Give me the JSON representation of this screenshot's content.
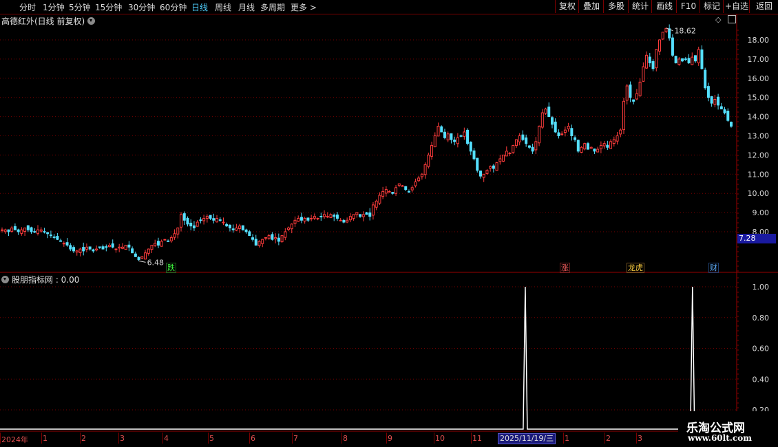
{
  "toolbar": {
    "timeframes": [
      {
        "label": "分时",
        "active": false
      },
      {
        "label": "1分钟",
        "active": false
      },
      {
        "label": "5分钟",
        "active": false
      },
      {
        "label": "15分钟",
        "active": false
      },
      {
        "label": "30分钟",
        "active": false
      },
      {
        "label": "60分钟",
        "active": false
      },
      {
        "label": "日线",
        "active": true
      },
      {
        "label": "周线",
        "active": false
      },
      {
        "label": "月线",
        "active": false
      },
      {
        "label": "多周期",
        "active": false
      },
      {
        "label": "更多 >",
        "active": false
      }
    ],
    "buttons": [
      "复权",
      "叠加",
      "多股",
      "统计",
      "画线",
      "F10",
      "标记",
      "+自选",
      "返回"
    ]
  },
  "main_chart": {
    "title": "高德红外(日线 前复权)",
    "high_label": "18.62",
    "low_label": "6.48",
    "current_price": "7.28",
    "colors": {
      "up": "#ff3c3c",
      "down": "#55e0ff",
      "grid": "#7a0000",
      "accent_blue": "#1a1aa0"
    },
    "markers": [
      {
        "text": "跌",
        "color": "#40ff40"
      },
      {
        "text": "涨",
        "color": "#ff6060"
      },
      {
        "text": "龙虎",
        "color": "#ffd040"
      },
      {
        "text": "财",
        "color": "#60b0ff"
      }
    ]
  },
  "indicator": {
    "title": "股朋指标网 : 0.00"
  },
  "x_axis": {
    "labels": [
      "2024年",
      "1",
      "2",
      "3",
      "4",
      "5",
      "6",
      "7",
      "8",
      "9",
      "10",
      "11",
      "1",
      "2",
      "3"
    ],
    "cursor_date": "2025/11/19/三"
  },
  "watermark": {
    "line1": "乐淘公式网",
    "line2": "www.60lt.com"
  },
  "chart_data": [
    {
      "type": "candlestick",
      "title": "高德红外(日线 前复权)",
      "y_ticks": [
        "18.00",
        "17.00",
        "16.00",
        "15.00",
        "14.00",
        "13.00",
        "12.00",
        "11.00",
        "10.00",
        "9.00",
        "8.00"
      ],
      "ylim": [
        6.0,
        19.0
      ],
      "n_bars": 225,
      "close_anchors": [
        [
          0,
          8.1
        ],
        [
          12,
          8.1
        ],
        [
          20,
          7.7
        ],
        [
          24,
          7.0
        ],
        [
          30,
          7.1
        ],
        [
          40,
          7.2
        ],
        [
          48,
          6.55
        ],
        [
          56,
          7.3
        ],
        [
          62,
          7.9
        ],
        [
          66,
          8.6
        ],
        [
          72,
          8.3
        ],
        [
          80,
          8.7
        ],
        [
          92,
          8.3
        ],
        [
          100,
          8.1
        ],
        [
          104,
          7.5
        ],
        [
          110,
          7.5
        ],
        [
          118,
          8.0
        ],
        [
          124,
          8.6
        ],
        [
          134,
          8.8
        ],
        [
          148,
          8.8
        ],
        [
          160,
          9.6
        ],
        [
          170,
          10.3
        ],
        [
          182,
          10.4
        ],
        [
          190,
          12.0
        ],
        [
          196,
          13.5
        ],
        [
          200,
          12.9
        ],
        [
          210,
          12.9
        ],
        [
          214,
          11.2
        ],
        [
          220,
          11.6
        ]
      ],
      "closes": [
        8.1,
        8.1,
        8.0,
        8.2,
        8.1,
        8.0,
        8.1,
        8.2,
        8.1,
        8.0,
        8.0,
        8.1,
        8.1,
        8.0,
        7.9,
        7.8,
        7.7,
        7.6,
        7.5,
        7.4,
        7.3,
        7.1,
        7.0,
        7.0,
        7.1,
        7.0,
        7.2,
        7.1,
        7.0,
        7.1,
        7.2,
        7.1,
        7.2,
        7.3,
        7.2,
        7.1,
        7.2,
        7.2,
        7.3,
        7.2,
        6.9,
        6.7,
        6.55,
        6.7,
        6.9,
        7.1,
        7.3,
        7.4,
        7.3,
        7.5,
        7.6,
        7.5,
        7.7,
        7.9,
        8.2,
        8.9,
        8.6,
        8.4,
        8.3,
        8.2,
        8.5,
        8.6,
        8.7,
        8.8,
        8.7,
        8.6,
        8.7,
        8.6,
        8.5,
        8.3,
        8.2,
        8.1,
        8.2,
        8.3,
        8.1,
        8.0,
        7.8,
        7.6,
        7.3,
        7.5,
        7.6,
        7.7,
        7.8,
        7.6,
        7.7,
        7.5,
        7.8,
        8.0,
        8.2,
        8.4,
        8.6,
        8.7,
        8.6,
        8.7,
        8.6,
        8.7,
        8.8,
        8.7,
        8.8,
        8.9,
        8.8,
        8.9,
        8.8,
        8.7,
        8.6,
        8.5,
        8.6,
        8.8,
        8.9,
        9.0,
        8.8,
        8.9,
        8.9,
        8.8,
        9.4,
        9.6,
        9.9,
        10.1,
        10.2,
        10.1,
        10.0,
        10.3,
        10.5,
        10.4,
        10.2,
        10.1,
        10.3,
        10.6,
        10.8,
        11.0,
        11.5,
        12.0,
        12.5,
        13.0,
        13.5,
        13.2,
        12.9,
        13.1,
        12.8,
        12.7,
        12.9,
        13.0,
        13.2,
        12.6,
        12.2,
        11.8,
        11.2,
        10.9,
        11.0,
        11.2,
        11.4,
        11.3,
        11.6,
        11.8,
        12.0,
        12.2,
        12.1,
        12.5,
        12.8,
        13.0,
        12.8,
        12.6,
        12.4,
        12.2,
        12.7,
        13.5,
        14.2,
        14.4,
        14.0,
        13.6,
        13.2,
        13.0,
        13.1,
        13.3,
        13.5,
        13.0,
        12.8,
        12.2,
        12.4,
        12.6,
        12.3,
        12.4,
        12.2,
        12.3,
        12.5,
        12.6,
        12.4,
        12.7,
        12.8,
        13.0,
        13.3,
        14.8,
        15.6,
        15.0,
        14.8,
        15.2,
        15.8,
        16.6,
        17.2,
        16.8,
        16.5,
        17.5,
        18.0,
        18.4,
        18.6,
        18.1,
        17.2,
        16.8,
        17.0,
        16.9,
        17.0,
        16.8,
        17.1,
        16.9,
        17.5,
        16.5,
        15.5,
        15.0,
        14.7,
        14.9,
        14.6,
        14.4,
        14.2,
        13.8,
        13.5
      ]
    },
    {
      "type": "line",
      "title": "股朋指标网",
      "y_ticks": [
        "1.00",
        "0.80",
        "0.60",
        "0.40",
        "0.20"
      ],
      "ylim": [
        0,
        1.05
      ],
      "spikes": [
        {
          "bar_fraction": 0.713,
          "value": 1.0
        },
        {
          "bar_fraction": 0.94,
          "value": 1.0
        }
      ],
      "baseline": 0.0
    }
  ]
}
